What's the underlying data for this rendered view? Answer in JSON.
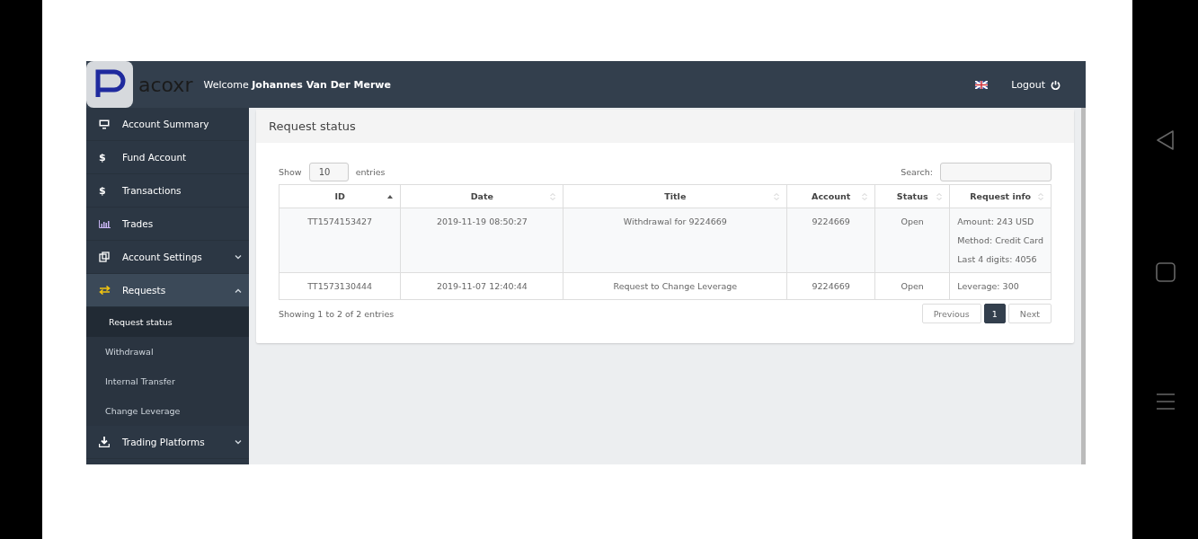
{
  "header": {
    "logo_text": "acoxr",
    "welcome": "Welcome",
    "user_name": "Johannes Van Der Merwe",
    "logout": "Logout"
  },
  "sidebar": {
    "items": [
      {
        "label": "Account Summary",
        "selected": false
      },
      {
        "icon_text": "$",
        "label": "Fund Account",
        "selected": false
      },
      {
        "icon_text": "$",
        "label": "Transactions",
        "selected": false
      },
      {
        "label": "Trades",
        "selected": false
      },
      {
        "label": "Account Settings",
        "selected": false,
        "expanded": false
      },
      {
        "label": "Requests",
        "selected": true,
        "expanded": true,
        "children": [
          {
            "label": "Request status",
            "selected": true
          },
          {
            "label": "Withdrawal",
            "selected": false
          },
          {
            "label": "Internal Transfer",
            "selected": false
          },
          {
            "label": "Change Leverage",
            "selected": false
          }
        ]
      },
      {
        "label": "Trading Platforms",
        "selected": false,
        "expanded": false
      }
    ]
  },
  "panel": {
    "title": "Request status",
    "show_label": "Show",
    "page_size": "10",
    "entries_label": "entries",
    "search_label": "Search:",
    "table": {
      "columns": [
        {
          "label": "ID",
          "sorted": true
        },
        {
          "label": "Date",
          "sorted": false
        },
        {
          "label": "Title",
          "sorted": false
        },
        {
          "label": "Account",
          "sorted": false
        },
        {
          "label": "Status",
          "sorted": false
        },
        {
          "label": "Request info",
          "sorted": false
        }
      ],
      "rows": [
        {
          "id": "TT1574153427",
          "date": "2019-11-19 08:50:27",
          "title": "Withdrawal for 9224669",
          "account": "9224669",
          "status": "Open",
          "info": [
            "Amount: 243 USD",
            "Method: Credit Card",
            "Last 4 digits: 4056"
          ]
        },
        {
          "id": "TT1573130444",
          "date": "2019-11-07 12:40:44",
          "title": "Request to Change Leverage",
          "account": "9224669",
          "status": "Open",
          "info": [
            "Leverage: 300"
          ]
        }
      ]
    },
    "summary": "Showing 1 to 2 of 2 entries",
    "pagination": {
      "previous": "Previous",
      "pages": [
        {
          "label": "1",
          "selected": true
        }
      ],
      "next": "Next"
    }
  }
}
